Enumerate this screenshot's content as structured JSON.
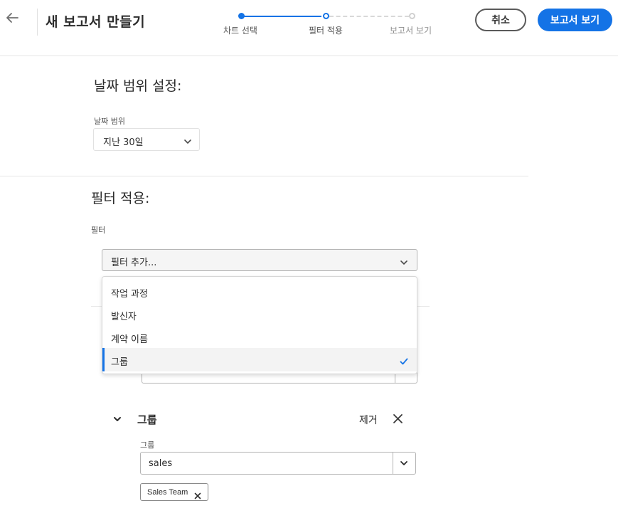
{
  "header": {
    "title": "새 보고서 만들기",
    "steps": [
      {
        "label": "차트 선택",
        "state": "complete"
      },
      {
        "label": "필터 적용",
        "state": "current"
      },
      {
        "label": "보고서 보기",
        "state": "upcoming"
      }
    ],
    "cancel_label": "취소",
    "view_report_label": "보고서 보기"
  },
  "date_range": {
    "section_title": "날짜 범위 설정:",
    "field_label": "날짜 범위",
    "selected": "지난 30일"
  },
  "filters": {
    "section_title": "필터 적용:",
    "field_label": "필터",
    "dropdown_placeholder": "필터 추가...",
    "options": [
      {
        "label": "작업 과정",
        "selected": false
      },
      {
        "label": "발신자",
        "selected": false
      },
      {
        "label": "계약 이름",
        "selected": false
      },
      {
        "label": "그룹",
        "selected": true
      }
    ]
  },
  "group_filter": {
    "heading": "그룹",
    "remove_label": "제거",
    "field_label": "그룹",
    "input_value": "sales",
    "tags": [
      "Sales Team"
    ]
  },
  "colors": {
    "accent": "#1473e6",
    "text": "#2c2c2c",
    "border": "#b3b3b3"
  }
}
